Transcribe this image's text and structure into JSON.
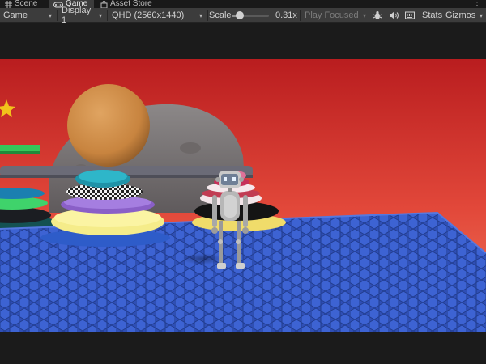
{
  "tabs": {
    "scene": "Scene",
    "game": "Game",
    "asset_store": "Asset Store",
    "menu": "⋮"
  },
  "toolbar": {
    "view_mode": "Game",
    "display": "Display 1",
    "resolution": "QHD (2560x1440)",
    "scale_label": "Scale",
    "scale_value": "0.31x",
    "scale_fraction": 0.1,
    "play_mode": "Play Focused",
    "stats_label": "Stats",
    "gizmos_label": "Gizmos",
    "caret": "▾"
  },
  "icons": {
    "scene": "hash-grid-icon",
    "game": "gamepad-icon",
    "asset_store": "shopping-bag-icon",
    "bug": "bug-icon",
    "audio": "speaker-icon",
    "stats": "keyboard-icon"
  },
  "colors": {
    "toolbar_bg": "#3c3c3c",
    "tabbar_bg": "#191919",
    "view_bg": "#1b1b1b",
    "sky_top": "#ba1d1d",
    "sky_bottom": "#ec6a52",
    "floor": "#3c61cf"
  }
}
